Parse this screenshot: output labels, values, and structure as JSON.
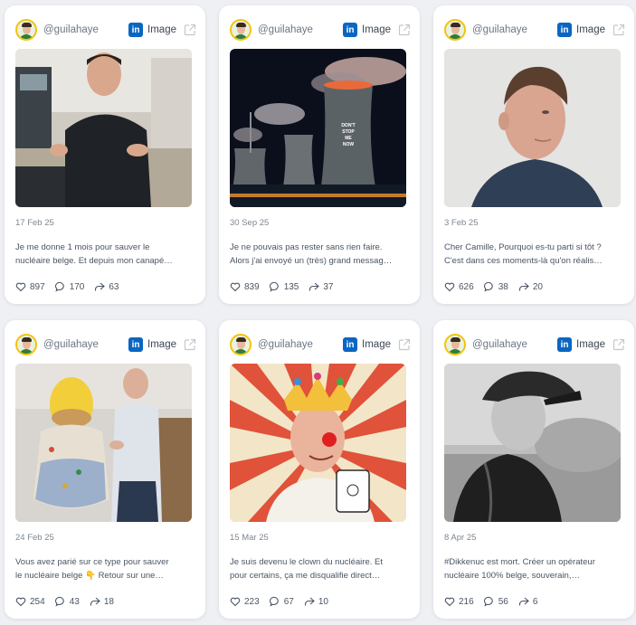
{
  "posts": [
    {
      "handle": "@guilahaye",
      "network_badge": "in",
      "type": "Image",
      "date": "17 Feb 25",
      "text_line1": "Je me donne 1 mois pour sauver le",
      "text_line2": "nucléaire belge. Et depuis mon canapé…",
      "likes": "897",
      "comments": "170",
      "shares": "63"
    },
    {
      "handle": "@guilahaye",
      "network_badge": "in",
      "type": "Image",
      "date": "30 Sep 25",
      "text_line1": "Je ne pouvais pas rester sans rien faire.",
      "text_line2": "Alors j'ai envoyé un (très) grand messag…",
      "likes": "839",
      "comments": "135",
      "shares": "37",
      "image_text": [
        "DON'T",
        "STOP",
        "ME",
        "NOW"
      ]
    },
    {
      "handle": "@guilahaye",
      "network_badge": "in",
      "type": "Image",
      "date": "3 Feb 25",
      "text_line1": "Cher Camille, Pourquoi es-tu parti si tôt ?",
      "text_line2": "C'est dans ces moments-là qu'on réalis…",
      "likes": "626",
      "comments": "38",
      "shares": "20"
    },
    {
      "handle": "@guilahaye",
      "network_badge": "in",
      "type": "Image",
      "date": "24 Feb 25",
      "text_line1": "Vous avez parié sur ce type pour sauver",
      "text_line2": "le nucléaire belge 👇 Retour sur une…",
      "likes": "254",
      "comments": "43",
      "shares": "18"
    },
    {
      "handle": "@guilahaye",
      "network_badge": "in",
      "type": "Image",
      "date": "15 Mar 25",
      "text_line1": "Je suis devenu le clown du nucléaire. Et",
      "text_line2": "pour certains, ça me disqualifie direct…",
      "likes": "223",
      "comments": "67",
      "shares": "10"
    },
    {
      "handle": "@guilahaye",
      "network_badge": "in",
      "type": "Image",
      "date": "8 Apr 25",
      "text_line1": "#Dikkenuc est mort. Créer un opérateur",
      "text_line2": "nucléaire 100% belge, souverain,…",
      "likes": "216",
      "comments": "56",
      "shares": "6"
    }
  ],
  "colors": {
    "linkedin": "#0a66c2",
    "avatar_ring": "#f1c40f",
    "card_bg": "#ffffff",
    "page_bg": "#eef0f3"
  },
  "icons": {
    "like": "heart-icon",
    "comment": "comment-icon",
    "share": "share-icon",
    "open": "external-link-icon",
    "network": "linkedin-icon"
  }
}
